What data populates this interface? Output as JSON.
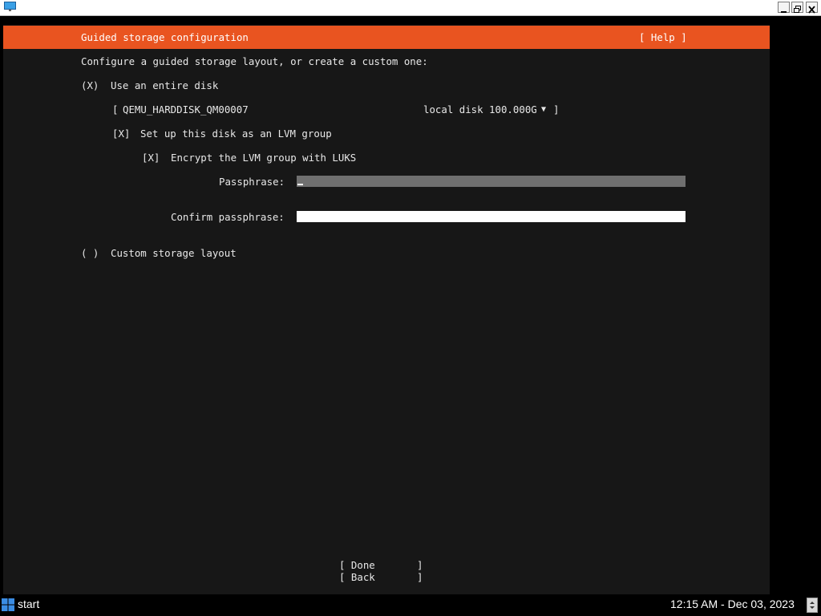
{
  "installer": {
    "title": "Guided storage configuration",
    "help_label": "[ Help ]",
    "prompt": "Configure a guided storage layout, or create a custom one:",
    "entire_disk": {
      "marker": "(X)",
      "label": "Use an entire disk"
    },
    "disk_select": {
      "open": "[",
      "name": "QEMU_HARDDISK_QM00007",
      "info": "local disk 100.000G",
      "arrow": "▼",
      "close": "]"
    },
    "lvm": {
      "marker": "[X]",
      "label": "Set up this disk as an LVM group"
    },
    "luks": {
      "marker": "[X]",
      "label": "Encrypt the LVM group with LUKS"
    },
    "passphrase": {
      "label": "Passphrase:",
      "value": ""
    },
    "confirm_passphrase": {
      "label": "Confirm passphrase:",
      "value": ""
    },
    "custom_layout": {
      "marker": "( )",
      "label": "Custom storage layout"
    },
    "buttons": {
      "done": "[ Done       ]",
      "back": "[ Back       ]"
    }
  },
  "taskbar": {
    "start_label": "start",
    "clock": "12:15 AM - Dec 03, 2023"
  },
  "colors": {
    "accent": "#e95420",
    "terminal_bg": "#171717",
    "text": "#e8e8e8"
  },
  "icons": {
    "app": "monitor-icon",
    "minimize": "minimize-icon",
    "restore": "restore-icon",
    "close": "close-icon",
    "start": "windows-logo-icon",
    "dropdown": "triangle-down-icon"
  }
}
